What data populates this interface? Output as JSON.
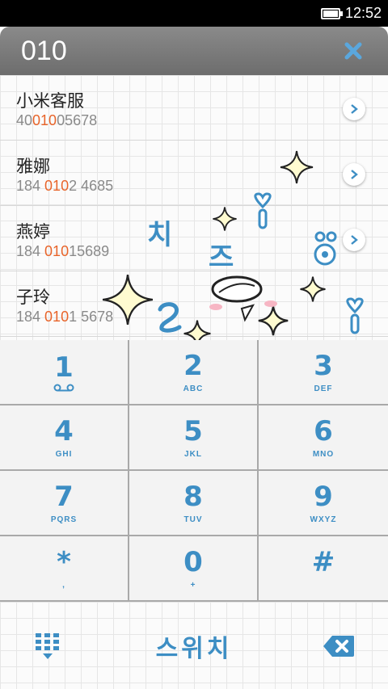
{
  "status_bar": {
    "time": "12:52",
    "battery_level": 0.9
  },
  "dialer": {
    "input": "010"
  },
  "contacts": [
    {
      "name": "小米客服",
      "number_pre": "40",
      "number_match": "010",
      "number_post": "05678"
    },
    {
      "name": "雅娜",
      "number_pre": "184 ",
      "number_match": "010",
      "number_post": "2 4685"
    },
    {
      "name": "燕婷",
      "number_pre": "184 ",
      "number_match": "010",
      "number_post": "15689"
    },
    {
      "name": "子玲",
      "number_pre": "184 ",
      "number_match": "010",
      "number_post": "1 5678"
    }
  ],
  "keypad": [
    {
      "digit": "1",
      "sub": ""
    },
    {
      "digit": "2",
      "sub": "ABC"
    },
    {
      "digit": "3",
      "sub": "DEF"
    },
    {
      "digit": "4",
      "sub": "GHI"
    },
    {
      "digit": "5",
      "sub": "JKL"
    },
    {
      "digit": "6",
      "sub": "MNO"
    },
    {
      "digit": "7",
      "sub": "PQRS"
    },
    {
      "digit": "8",
      "sub": "TUV"
    },
    {
      "digit": "9",
      "sub": "WXYZ"
    },
    {
      "digit": "*",
      "sub": ","
    },
    {
      "digit": "0",
      "sub": "+"
    },
    {
      "digit": "#",
      "sub": ""
    }
  ],
  "actions": {
    "switch_label": "스위치"
  },
  "decoration_text": {
    "korean_1": "치",
    "korean_2": "즈"
  },
  "colors": {
    "accent_blue": "#3d8ec4",
    "match_orange": "#e8642a",
    "header_gray": "#7a7a7a"
  },
  "icons": [
    "battery-icon",
    "clear-icon",
    "chevron-right-icon",
    "voicemail-icon",
    "keypad-toggle-icon",
    "backspace-icon"
  ]
}
